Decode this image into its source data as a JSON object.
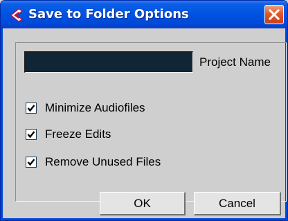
{
  "window": {
    "title": "Save to Folder Options",
    "colors": {
      "titlebar": "#0052e0",
      "close_button": "#e0582a",
      "body": "#cfcfcf",
      "name_field": "#102535"
    }
  },
  "project_name": {
    "value": "",
    "label": "Project Name"
  },
  "options": [
    {
      "label": "Minimize Audiofiles",
      "checked": true
    },
    {
      "label": "Freeze Edits",
      "checked": true
    },
    {
      "label": "Remove Unused Files",
      "checked": true
    }
  ],
  "buttons": {
    "ok": "OK",
    "cancel": "Cancel"
  },
  "icons": {
    "app": "cubase-logo-icon",
    "close": "close-icon",
    "check": "checkmark-icon"
  }
}
